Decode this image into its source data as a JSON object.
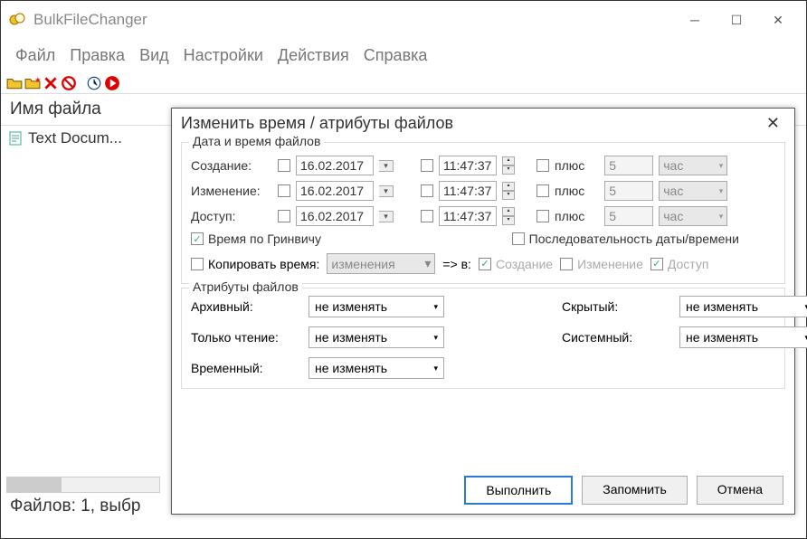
{
  "app": {
    "title": "BulkFileChanger"
  },
  "menu": {
    "file": "Файл",
    "edit": "Правка",
    "view": "Вид",
    "settings": "Настройки",
    "actions": "Действия",
    "help": "Справка"
  },
  "list": {
    "header_filename": "Имя файла",
    "row0": "Text Docum..."
  },
  "status": "Файлов: 1, выбр",
  "dialog": {
    "title": "Изменить время / атрибуты файлов",
    "fs_datetime": "Дата и время файлов",
    "fs_attributes": "Атрибуты файлов",
    "labels": {
      "created": "Создание:",
      "modified": "Изменение:",
      "accessed": "Доступ:",
      "plus": "плюс",
      "greenwich": "Время по Гринвичу",
      "sequence": "Последовательность даты/времени",
      "copytime": "Копировать время:",
      "arrow_to": "=> в:",
      "cb_created": "Создание",
      "cb_modified": "Изменение",
      "cb_accessed": "Доступ",
      "archive": "Архивный:",
      "readonly": "Только чтение:",
      "temp": "Временный:",
      "hidden": "Скрытый:",
      "system": "Системный:"
    },
    "values": {
      "date": "16.02.2017",
      "time": "11:47:37",
      "offset": "5",
      "unit": "час",
      "copytime_src": "изменения",
      "nochange": "не изменять"
    },
    "buttons": {
      "execute": "Выполнить",
      "remember": "Запомнить",
      "cancel": "Отмена"
    }
  }
}
